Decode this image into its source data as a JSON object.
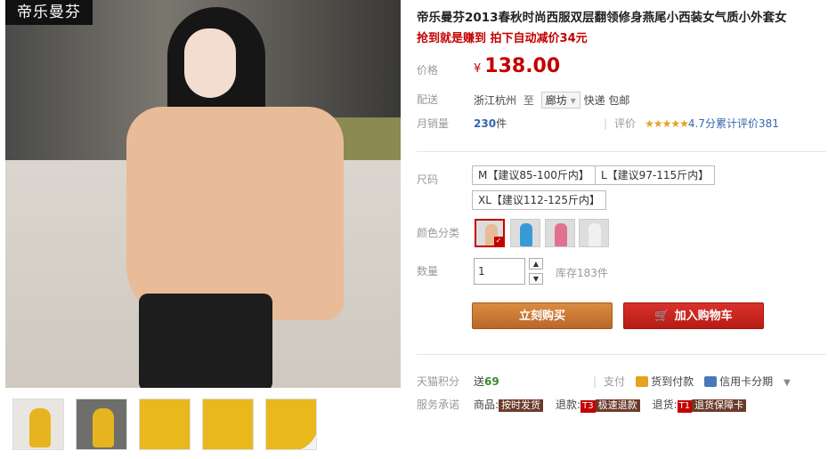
{
  "brand": "帝乐曼芬",
  "product": {
    "title": "帝乐曼芬2013春秋时尚西服双层翻领修身燕尾小西装女气质小外套女",
    "promo": "抢到就是赚到 拍下自动减价34元"
  },
  "price": {
    "label": "价格",
    "currency": "¥",
    "value": "138.00"
  },
  "shipping": {
    "label": "配送",
    "from": "浙江杭州",
    "to_word": "至",
    "dest": "廊坊",
    "note": "快递 包邮"
  },
  "sales": {
    "label": "月销量",
    "count": "230",
    "unit": "件"
  },
  "rating": {
    "label": "评价",
    "stars": "★★★★★",
    "text": "4.7分累计评价381",
    "score": 4.7
  },
  "sizes": {
    "label": "尺码",
    "options": [
      "M【建议85-100斤内】",
      "L【建议97-115斤内】",
      "XL【建议112-125斤内】"
    ]
  },
  "colors": {
    "label": "颜色分类",
    "swatch_colors": [
      "#e8bc98",
      "#3a9ad8",
      "#e27090",
      "#f0f0f0"
    ],
    "selected_index": 0
  },
  "quantity": {
    "label": "数量",
    "value": "1",
    "stock": "库存183件"
  },
  "buttons": {
    "buy_now": "立刻购买",
    "add_to_cart": "加入购物车",
    "cart_icon": "🛒"
  },
  "points": {
    "label": "天猫积分",
    "prefix": "送",
    "value": "69"
  },
  "payment": {
    "label": "支付",
    "cod": "货到付款",
    "credit": "信用卡分期",
    "chevron": "▼"
  },
  "service": {
    "label": "服务承诺",
    "goods_label": "商品:",
    "goods_tag": "按时发货",
    "refund_label": "退款:",
    "refund_badge": "T3",
    "refund_tag": "极速退款",
    "return_label": "退货:",
    "return_badge": "T1",
    "return_tag": "退货保障卡"
  }
}
